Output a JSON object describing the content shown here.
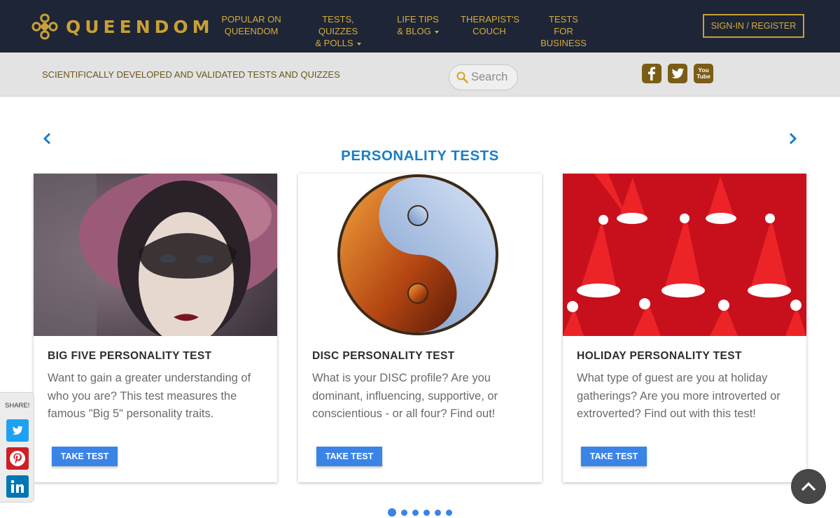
{
  "brand": {
    "name": "QUEENDOM"
  },
  "nav": {
    "popular": "POPULAR ON\nQUEENDOM",
    "tests": "TESTS, QUIZZES\n& POLLS",
    "lifetips": "LIFE TIPS\n& BLOG",
    "therapist": "THERAPIST'S\nCOUCH",
    "business": "TESTS FOR\nBUSINESS",
    "signin": "SIGN-IN / REGISTER"
  },
  "subbar": {
    "tagline": "SCIENTIFICALLY DEVELOPED AND VALIDATED TESTS AND QUIZZES",
    "search_placeholder": "Search",
    "social_icons": [
      "facebook-icon",
      "twitter-icon",
      "youtube-icon"
    ],
    "youtube_text": "You Tube"
  },
  "carousel": {
    "title": "PERSONALITY TESTS",
    "cards": [
      {
        "title": "BIG FIVE PERSONALITY TEST",
        "desc": "Want to gain a greater understanding of who you are? This test measures the famous \"Big 5\" personality traits.",
        "button": "TAKE TEST"
      },
      {
        "title": "DISC PERSONALITY TEST",
        "desc": "What is your DISC profile? Are you dominant, influencing, supportive, or conscientious - or all four? Find out!",
        "button": "TAKE TEST"
      },
      {
        "title": "HOLIDAY PERSONALITY TEST",
        "desc": "What type of guest are you at holiday gatherings? Are you more introverted or extroverted? Find out with this test!",
        "button": "TAKE TEST"
      }
    ],
    "page_count": 6,
    "active_page": 1
  },
  "share": {
    "label": "SHARE!",
    "networks": [
      "twitter",
      "pinterest",
      "linkedin"
    ]
  },
  "colors": {
    "nav_bg": "#1e2536",
    "gold": "#d5ac3c",
    "accent_blue": "#1b7ec4",
    "button_blue": "#3a84e8"
  }
}
